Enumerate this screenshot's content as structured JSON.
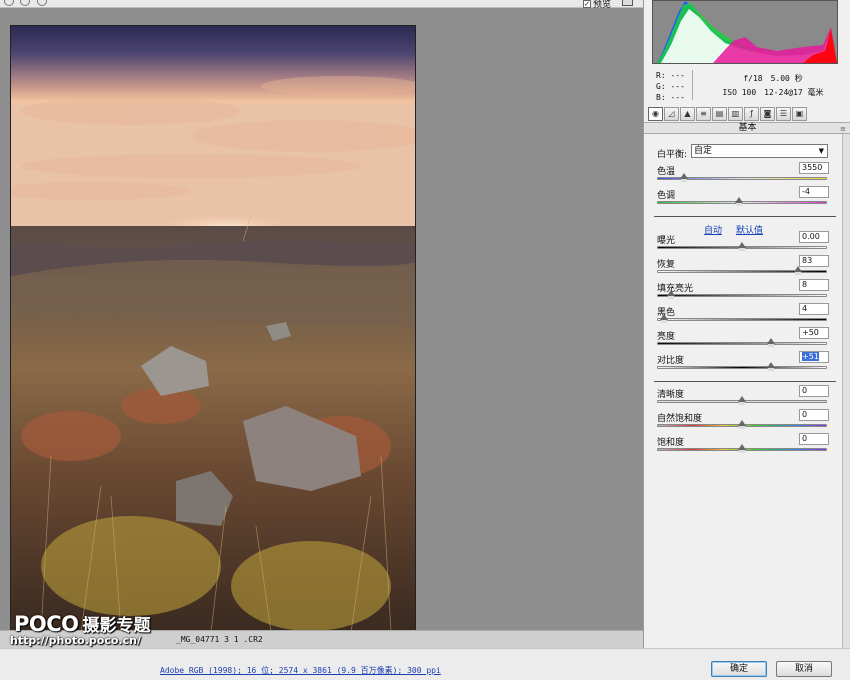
{
  "toolbar": {
    "preview_label": "预览",
    "preview_checked": "✓"
  },
  "file": {
    "name": "_MG_04771 3 1 .CR2"
  },
  "footer": {
    "workflow_link": "Adobe RGB (1998); 16 位; 2574 x 3861 (9.9 百万像素); 300 ppi",
    "ok_label": "确定",
    "cancel_label": "取消"
  },
  "watermark": {
    "logo": "POCO",
    "title": "摄影专题",
    "url": "http://photo.poco.cn/"
  },
  "info": {
    "r": "R:  ---",
    "g": "G:  ---",
    "b": "B:  ---",
    "aperture": "f/18",
    "shutter": "5.00 秒",
    "iso": "ISO 100",
    "lens": "12-24@17 毫米"
  },
  "tab_title": "基本",
  "white_balance": {
    "label": "白平衡:",
    "value": "自定"
  },
  "links": {
    "auto": "自动",
    "default": "默认值"
  },
  "sliders": [
    {
      "name": "temperature",
      "label": "色温",
      "value": "3550",
      "pos": 0.16
    },
    {
      "name": "tint",
      "label": "色调",
      "value": "-4",
      "pos": 0.48
    },
    {
      "name": "exposure",
      "label": "曝光",
      "value": "0.00",
      "pos": 0.5
    },
    {
      "name": "recovery",
      "label": "恢复",
      "value": "83",
      "pos": 0.83
    },
    {
      "name": "fill-light",
      "label": "填充亮光",
      "value": "8",
      "pos": 0.08
    },
    {
      "name": "blacks",
      "label": "黑色",
      "value": "4",
      "pos": 0.04
    },
    {
      "name": "brightness",
      "label": "亮度",
      "value": "+50",
      "pos": 0.67
    },
    {
      "name": "contrast",
      "label": "对比度",
      "value": "+51",
      "pos": 0.67
    },
    {
      "name": "clarity",
      "label": "清晰度",
      "value": "0",
      "pos": 0.5
    },
    {
      "name": "vibrance",
      "label": "自然饱和度",
      "value": "0",
      "pos": 0.5
    },
    {
      "name": "saturation",
      "label": "饱和度",
      "value": "0",
      "pos": 0.5
    }
  ],
  "icons": {
    "tabs": [
      "basic-icon",
      "tone-curve-icon",
      "detail-icon",
      "hsl-icon",
      "split-toning-icon",
      "lens-icon",
      "effects-icon",
      "camera-calibration-icon",
      "presets-icon",
      "snapshots-icon"
    ]
  },
  "colors": {
    "accent": "#3b6fd6",
    "link": "#1744b5",
    "ok_border": "#3c7fb1"
  }
}
